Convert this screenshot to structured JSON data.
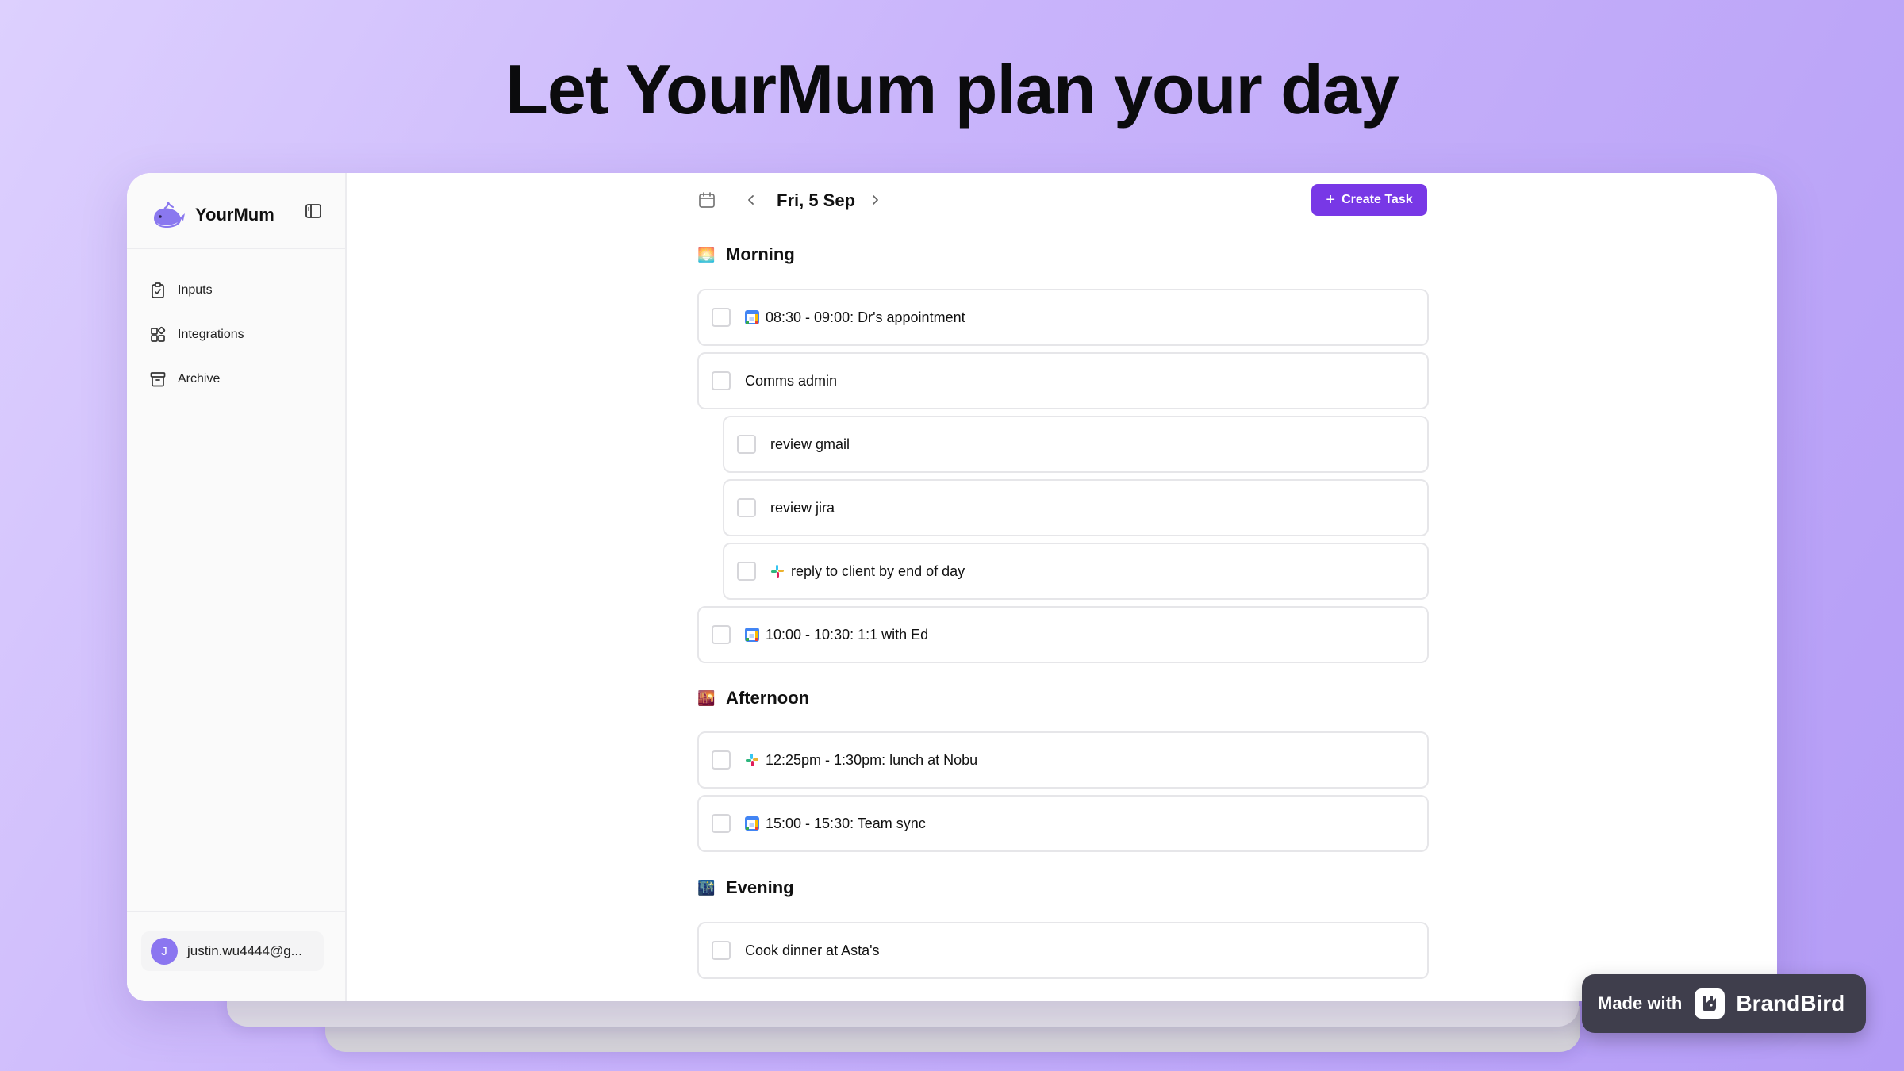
{
  "headline": "Let YourMum plan your day",
  "app": {
    "name": "YourMum"
  },
  "sidebar": {
    "items": [
      {
        "label": "Inputs",
        "icon": "clipboard-icon"
      },
      {
        "label": "Integrations",
        "icon": "integrations-icon"
      },
      {
        "label": "Archive",
        "icon": "archive-icon"
      }
    ],
    "user": {
      "initial": "J",
      "email": "justin.wu4444@g..."
    }
  },
  "toolbar": {
    "date": "Fri, 5 Sep",
    "create_label": "Create Task"
  },
  "sections": {
    "morning": {
      "title": "Morning",
      "emoji": "🌅"
    },
    "afternoon": {
      "title": "Afternoon",
      "emoji": "🌇"
    },
    "evening": {
      "title": "Evening",
      "emoji": "🌃"
    }
  },
  "tasks": [
    {
      "text": "08:30 - 09:00: Dr's appointment",
      "source": "google-calendar-icon",
      "checked": false
    },
    {
      "text": "Comms admin",
      "source": "",
      "checked": false
    },
    {
      "text": "review gmail",
      "source": "",
      "checked": false,
      "subtask": true
    },
    {
      "text": "review jira",
      "source": "",
      "checked": false,
      "subtask": true
    },
    {
      "text": "reply to client by end of day",
      "source": "slack-icon",
      "checked": false,
      "subtask": true
    },
    {
      "text": "10:00 - 10:30: 1:1 with Ed",
      "source": "google-calendar-icon",
      "checked": false
    },
    {
      "text": "12:25pm - 1:30pm: lunch at Nobu",
      "source": "slack-icon",
      "checked": false
    },
    {
      "text": "15:00 - 15:30: Team sync",
      "source": "google-calendar-icon",
      "checked": false
    },
    {
      "text": "Cook dinner at Asta's",
      "source": "",
      "checked": false
    }
  ],
  "badge": {
    "made_with": "Made with",
    "brand": "BrandBird"
  },
  "colors": {
    "accent": "#7838e6",
    "avatar": "#8b76f0",
    "badge_bg": "#3f3e4c"
  }
}
